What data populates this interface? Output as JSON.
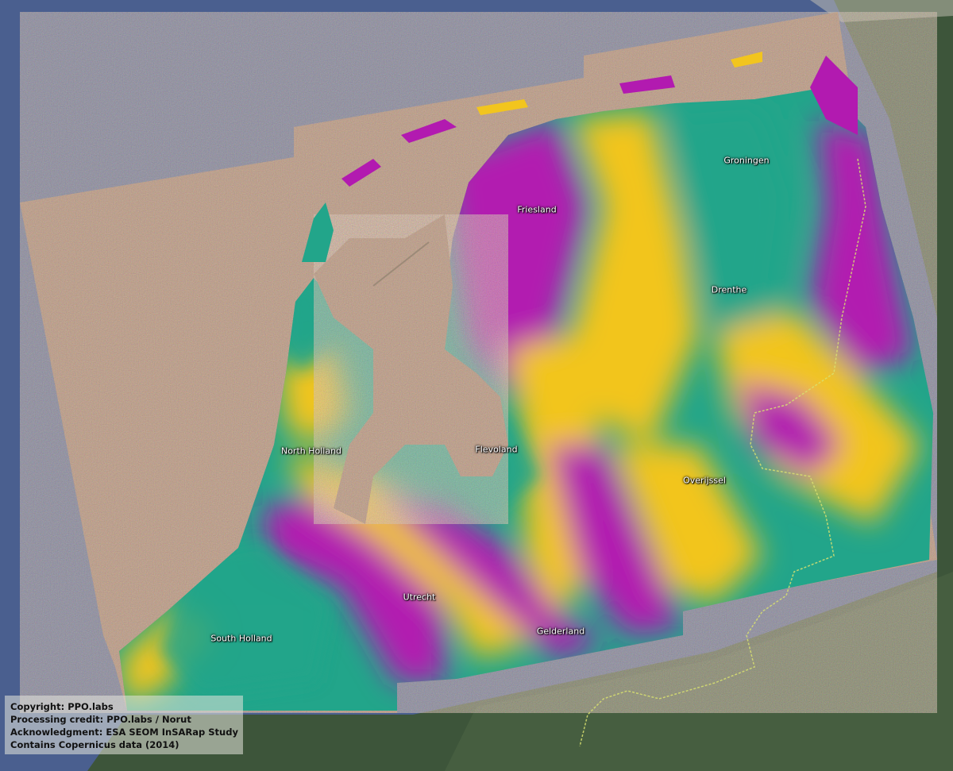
{
  "provinces": [
    {
      "id": "groningen",
      "name": "Groningen"
    },
    {
      "id": "friesland",
      "name": "Friesland"
    },
    {
      "id": "drenthe",
      "name": "Drenthe"
    },
    {
      "id": "north-holland",
      "name": "North Holland"
    },
    {
      "id": "flevoland",
      "name": "Flevoland"
    },
    {
      "id": "overijssel",
      "name": "Overijssel"
    },
    {
      "id": "utrecht",
      "name": "Utrecht"
    },
    {
      "id": "south-holland",
      "name": "South Holland"
    },
    {
      "id": "gelderland",
      "name": "Gelderland"
    }
  ],
  "credits": {
    "copyright": "Copyright: PPO.labs",
    "processing": "Processing credit: PPO.labs / Norut",
    "acknowledgment": "Acknowledgment: ESA SEOM InSARap Study",
    "data": "Contains Copernicus data (2014)"
  },
  "colors": {
    "sea": "#4a5f8f",
    "land": "#3f5a3a",
    "noise": "#a07a62",
    "magenta": "#b21ab0",
    "yellow": "#f2c51e",
    "green": "#22a58a",
    "border": "#d8e070"
  }
}
